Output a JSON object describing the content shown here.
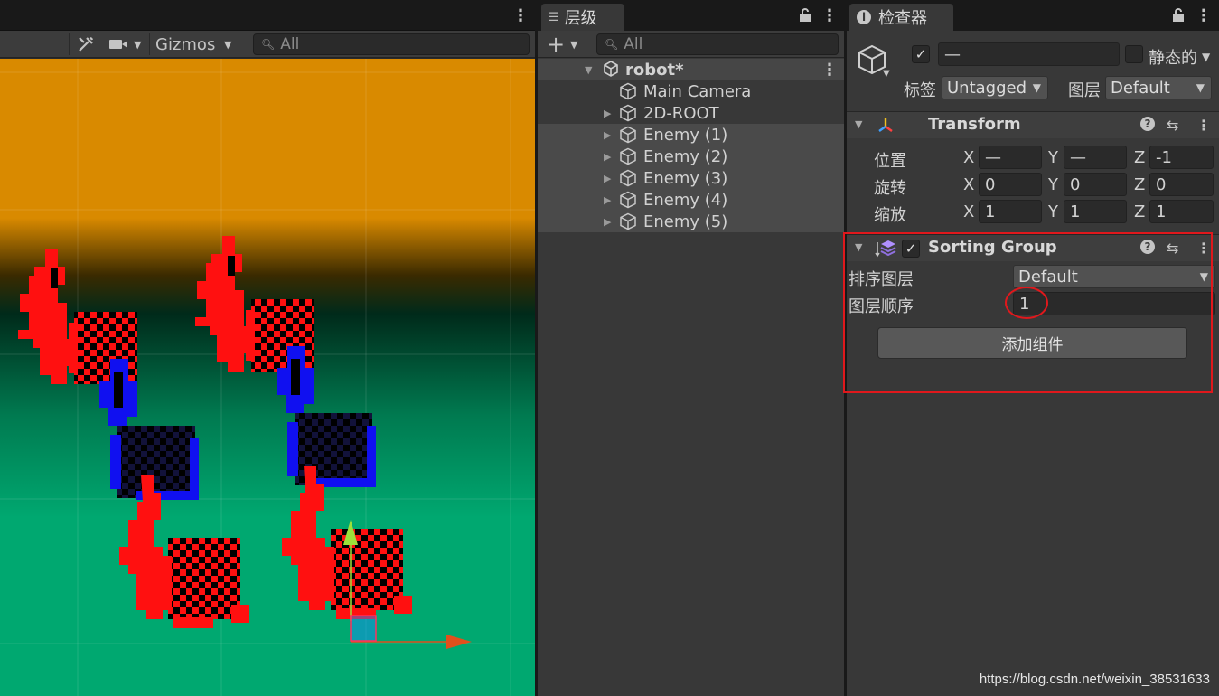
{
  "scene": {
    "gizmos_label": "Gizmos",
    "search_placeholder": "All"
  },
  "hierarchy": {
    "tab_label": "层级",
    "search_placeholder": "All",
    "scene_name": "robot*",
    "items": [
      {
        "label": "Main Camera"
      },
      {
        "label": "2D-ROOT"
      },
      {
        "label": "Enemy (1)"
      },
      {
        "label": "Enemy (2)"
      },
      {
        "label": "Enemy (3)"
      },
      {
        "label": "Enemy (4)"
      },
      {
        "label": "Enemy (5)"
      }
    ]
  },
  "inspector": {
    "tab_label": "检查器",
    "name_value": "—",
    "static_label": "静态的",
    "tag_label": "标签",
    "tag_value": "Untagged",
    "layer_label": "图层",
    "layer_value": "Default",
    "transform": {
      "title": "Transform",
      "position_label": "位置",
      "rotation_label": "旋转",
      "scale_label": "缩放",
      "position": {
        "x": "—",
        "y": "—",
        "z": "-1"
      },
      "rotation": {
        "x": "0",
        "y": "0",
        "z": "0"
      },
      "scale": {
        "x": "1",
        "y": "1",
        "z": "1"
      }
    },
    "sorting_group": {
      "title": "Sorting Group",
      "sorting_layer_label": "排序图层",
      "sorting_layer_value": "Default",
      "order_label": "图层顺序",
      "order_value": "1"
    },
    "add_component_label": "添加组件"
  },
  "axis_letters": {
    "x": "X",
    "y": "Y",
    "z": "Z"
  },
  "watermark": "https://blog.csdn.net/weixin_38531633",
  "colors": {
    "scene_sky": "#d98a00",
    "scene_ground": "#00a870",
    "enemy_red": "#ff1010",
    "enemy_blue": "#1010f0",
    "highlight_red": "#e0181c"
  }
}
